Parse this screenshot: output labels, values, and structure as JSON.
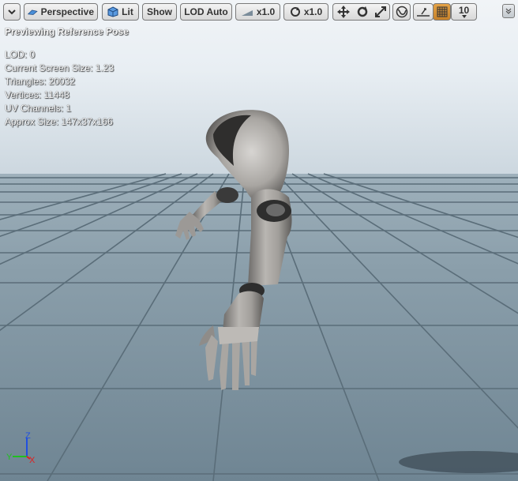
{
  "toolbar": {
    "perspective_label": "Perspective",
    "lit_label": "Lit",
    "show_label": "Show",
    "lod_label": "LOD Auto",
    "speed1_value": "x1.0",
    "speed2_value": "x1.0",
    "grid_value": "10"
  },
  "viewport": {
    "preview_label": "Previewing Reference Pose",
    "stats": {
      "lod": "LOD: 0",
      "screen_size": "Current Screen Size: 1.23",
      "triangles": "Triangles: 20032",
      "vertices": "Vertices: 11448",
      "uv_channels": "UV Channels: 1",
      "approx_size": "Approx Size: 147x37x166"
    },
    "axis": {
      "z": "Z",
      "y": "Y",
      "x": "X"
    }
  },
  "colors": {
    "axis_x": "#e02020",
    "axis_y": "#20c020",
    "axis_z": "#2050e0",
    "active_button": "#d9932f"
  }
}
